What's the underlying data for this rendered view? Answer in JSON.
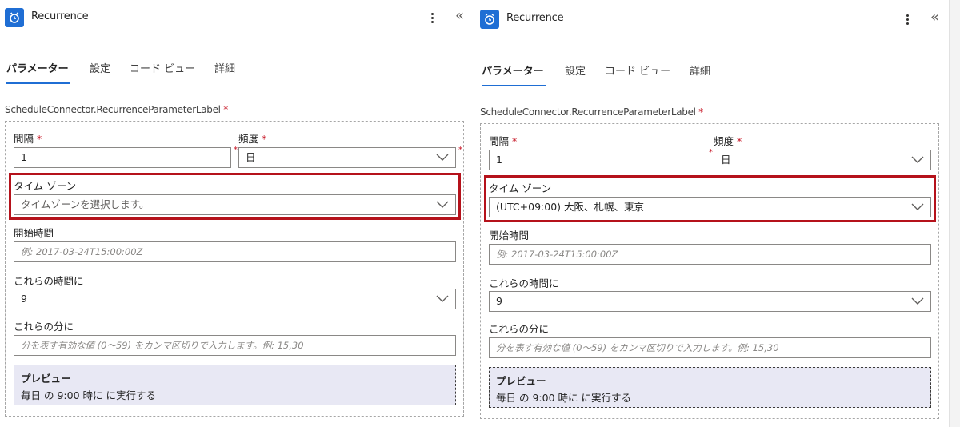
{
  "panels": [
    {
      "title": "Recurrence",
      "tabs": [
        "パラメーター",
        "設定",
        "コード ビュー",
        "詳細"
      ],
      "param_label": "ScheduleConnector.RecurrenceParameterLabel",
      "required_mark": "*",
      "interval": {
        "label": "間隔",
        "value": "1"
      },
      "frequency": {
        "label": "頻度",
        "value": "日"
      },
      "timezone": {
        "label": "タイム ゾーン",
        "value": "タイムゾーンを選択します。",
        "is_placeholder": true
      },
      "start_time": {
        "label": "開始時間",
        "placeholder": "例: 2017-03-24T15:00:00Z"
      },
      "at_hours": {
        "label": "これらの時間に",
        "value": "9"
      },
      "at_minutes": {
        "label": "これらの分に",
        "placeholder": "分を表す有効な値 (0～59) をカンマ区切りで入力します。例: 15,30"
      },
      "preview": {
        "title": "プレビュー",
        "text": "毎日 の 9:00 時に に実行する"
      }
    },
    {
      "title": "Recurrence",
      "tabs": [
        "パラメーター",
        "設定",
        "コード ビュー",
        "詳細"
      ],
      "param_label": "ScheduleConnector.RecurrenceParameterLabel",
      "required_mark": "*",
      "interval": {
        "label": "間隔",
        "value": "1"
      },
      "frequency": {
        "label": "頻度",
        "value": "日"
      },
      "timezone": {
        "label": "タイム ゾーン",
        "value": "(UTC+09:00) 大阪、札幌、東京",
        "is_placeholder": false
      },
      "start_time": {
        "label": "開始時間",
        "placeholder": "例: 2017-03-24T15:00:00Z"
      },
      "at_hours": {
        "label": "これらの時間に",
        "value": "9"
      },
      "at_minutes": {
        "label": "これらの分に",
        "placeholder": "分を表す有効な値 (0～59) をカンマ区切りで入力します。例: 15,30"
      },
      "preview": {
        "title": "プレビュー",
        "text": "毎日 の 9:00 時に に実行する"
      }
    }
  ],
  "colors": {
    "accent": "#1f6ed4",
    "highlight": "#b5121b",
    "required": "#c50f1f",
    "preview_bg": "#e8e8f4"
  },
  "icons": {
    "app": "alarm-clock-icon",
    "more": "more-vertical-icon",
    "collapse": "chevron-double-left-icon",
    "dropdown": "chevron-down-icon"
  }
}
